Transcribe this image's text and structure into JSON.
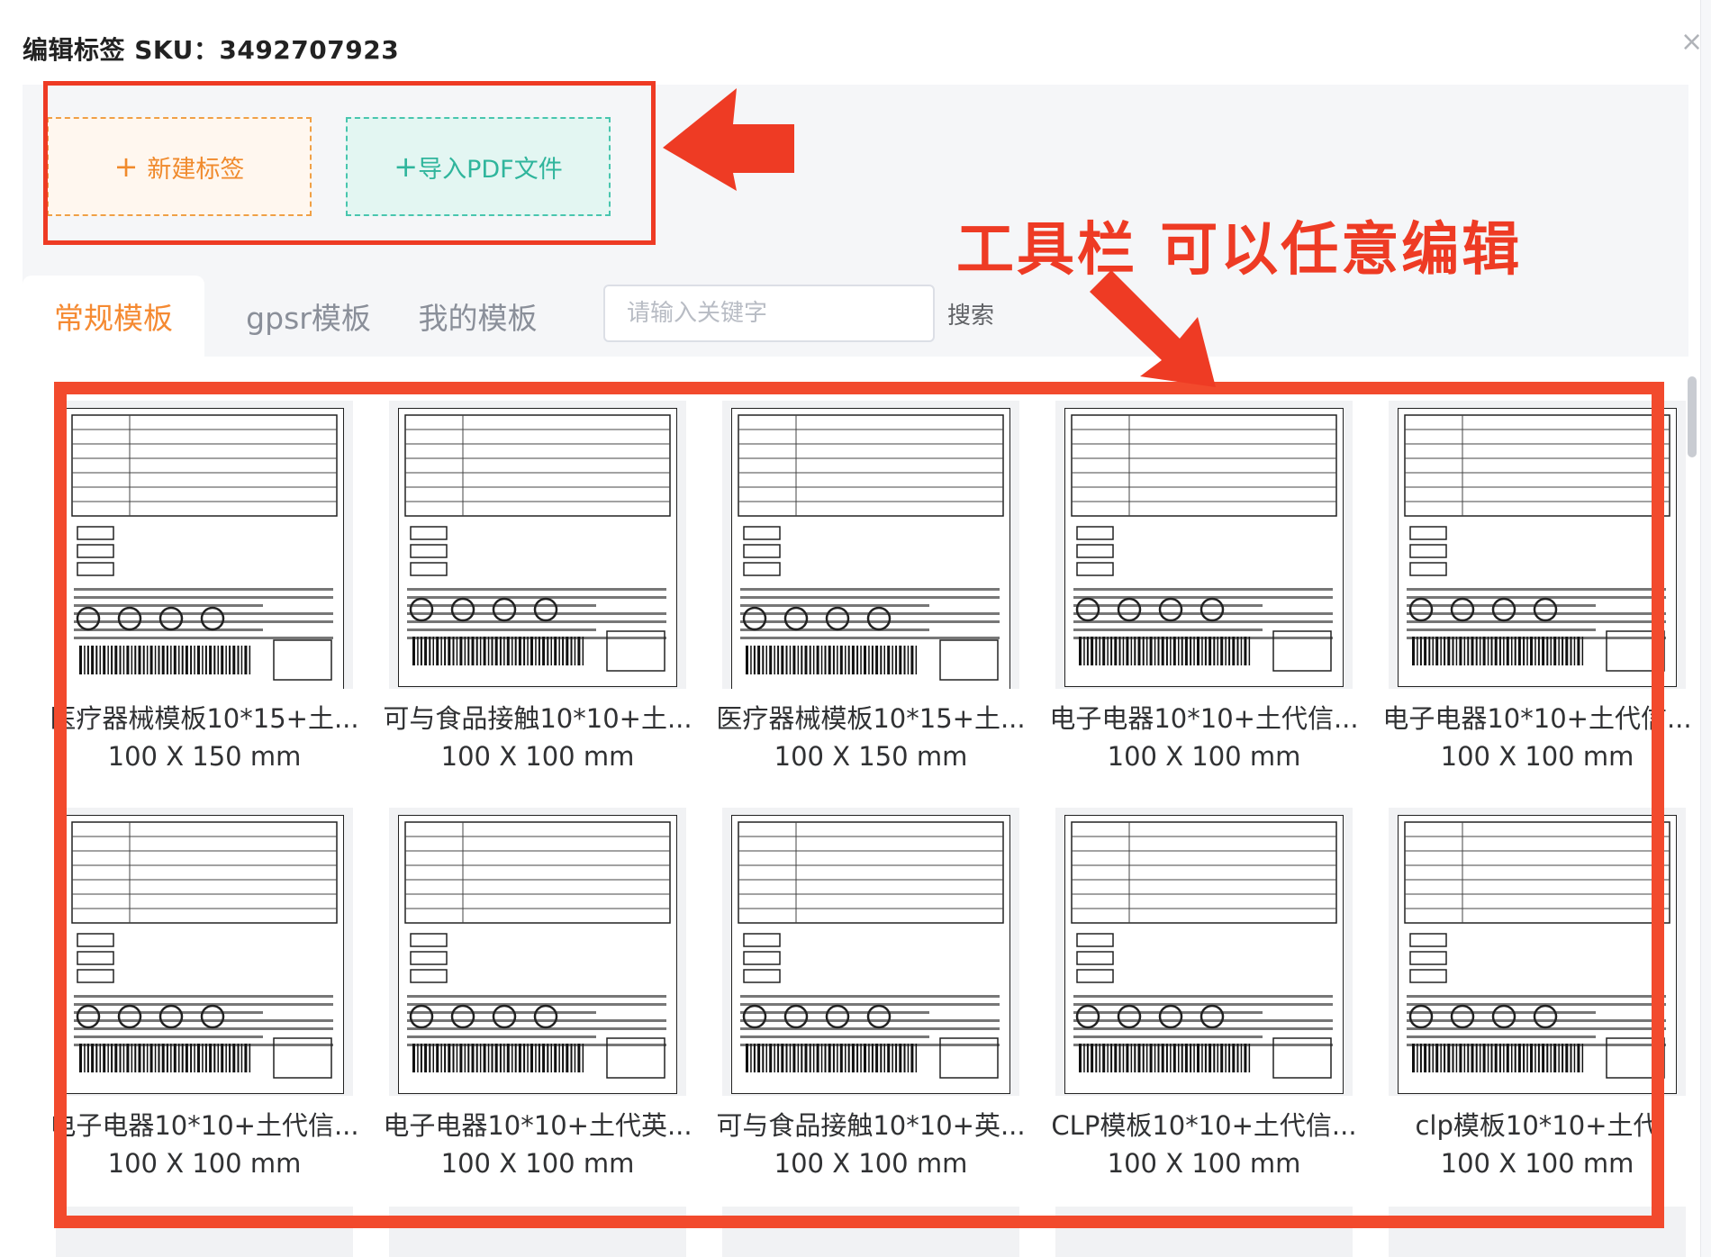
{
  "dialog": {
    "title": "编辑标签 SKU：3492707923",
    "close_glyph": "×"
  },
  "toolbar": {
    "new_label": {
      "icon": "plus-icon",
      "glyph": "+",
      "label": "新建标签"
    },
    "import_pdf": {
      "icon": "plus-icon",
      "glyph": "+",
      "label": "导入PDF文件"
    }
  },
  "tabs": [
    {
      "label": "常规模板",
      "active": true
    },
    {
      "label": "gpsr模板",
      "active": false
    },
    {
      "label": "我的模板",
      "active": false
    }
  ],
  "search": {
    "placeholder": "请输入关键字",
    "button_label": "搜索"
  },
  "templates": [
    {
      "title": "医疗器械模板10*15+土...",
      "size": "100 X 150 mm"
    },
    {
      "title": "可与食品接触10*10+土...",
      "size": "100 X 100 mm"
    },
    {
      "title": "医疗器械模板10*15+土...",
      "size": "100 X 150 mm"
    },
    {
      "title": "电子电器10*10+土代信...",
      "size": "100 X 100 mm"
    },
    {
      "title": "电子电器10*10+土代信...",
      "size": "100 X 100 mm"
    },
    {
      "title": "电子电器10*10+土代信...",
      "size": "100 X 100 mm"
    },
    {
      "title": "电子电器10*10+土代英...",
      "size": "100 X 100 mm"
    },
    {
      "title": "可与食品接触10*10+英...",
      "size": "100 X 100 mm"
    },
    {
      "title": "CLP模板10*10+土代信...",
      "size": "100 X 100 mm"
    },
    {
      "title": "clp模板10*10+土代",
      "size": "100 X 100 mm"
    }
  ],
  "annotation": {
    "text": "工具栏 可以任意编辑",
    "color": "#ee3b24"
  },
  "colors": {
    "accent": "#f58a32",
    "teal": "#2fb59c",
    "annotation_red": "#ee3b24"
  }
}
